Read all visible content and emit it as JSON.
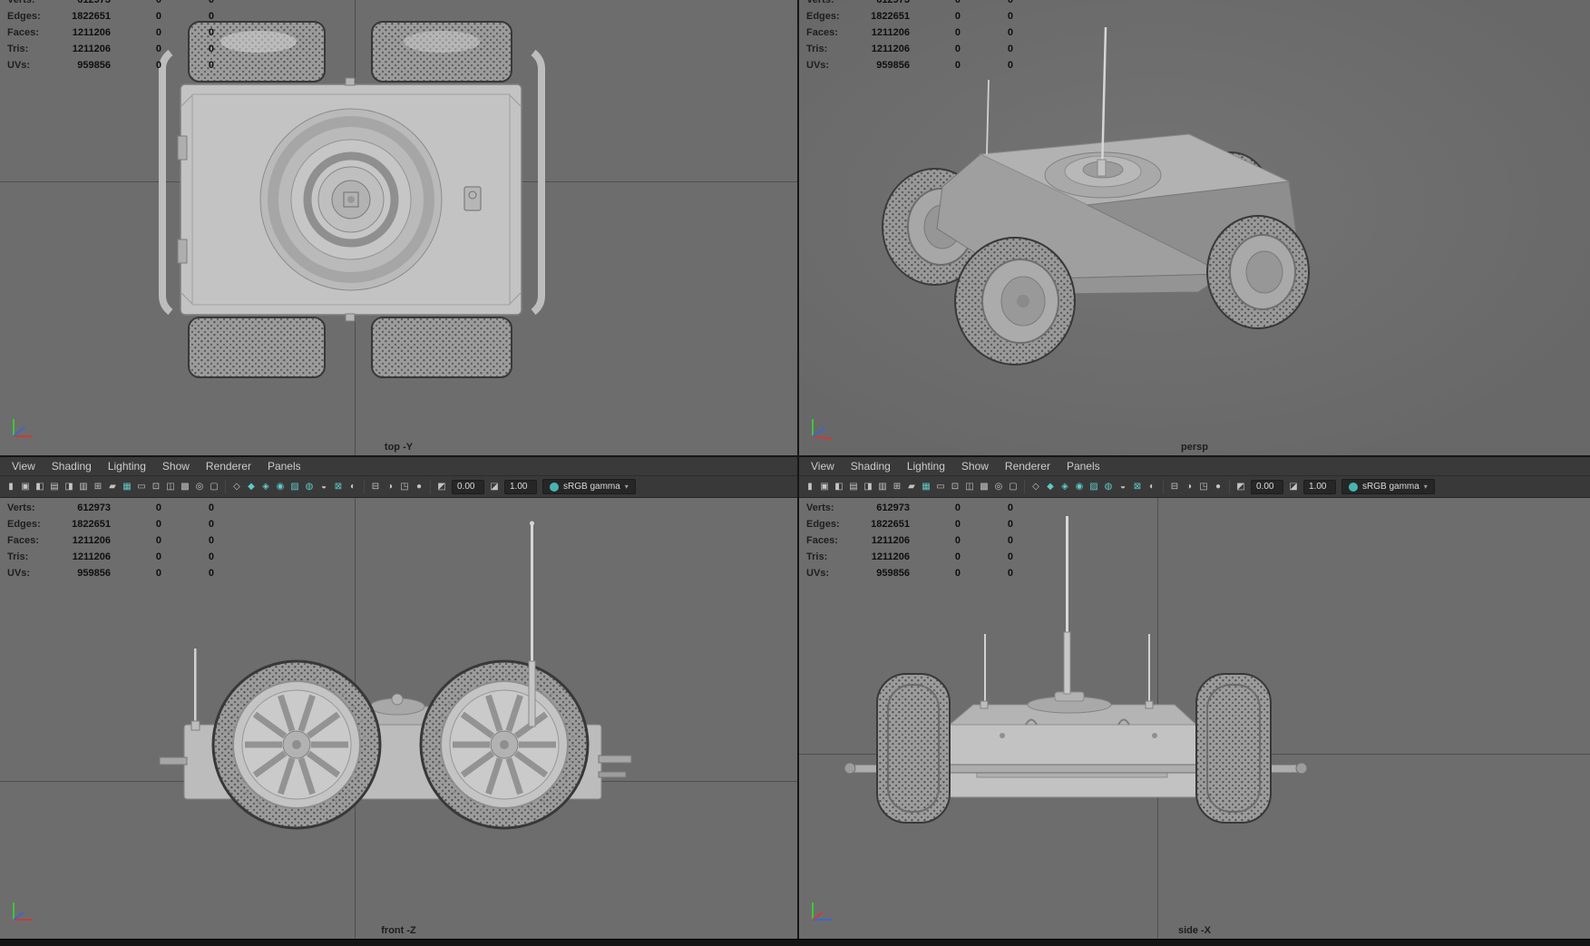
{
  "colors": {
    "viewport_bg": "#6d6d6d",
    "menubar_bg": "#3a3a3a",
    "toolbar_bg": "#393939",
    "accent_teal": "#5fc9c9",
    "axis_x_red": "#cc3a3a",
    "axis_y_green": "#3fc43f",
    "axis_z_blue": "#3c66cc"
  },
  "stats": {
    "rows": [
      {
        "label": "Verts:",
        "v1": "612973",
        "v2": "0",
        "v3": "0"
      },
      {
        "label": "Edges:",
        "v1": "1822651",
        "v2": "0",
        "v3": "0"
      },
      {
        "label": "Faces:",
        "v1": "1211206",
        "v2": "0",
        "v3": "0"
      },
      {
        "label": "Tris:",
        "v1": "1211206",
        "v2": "0",
        "v3": "0"
      },
      {
        "label": "UVs:",
        "v1": "959856",
        "v2": "0",
        "v3": "0"
      }
    ]
  },
  "panel_menu": {
    "items": [
      "View",
      "Shading",
      "Lighting",
      "Show",
      "Renderer",
      "Panels"
    ]
  },
  "toolbar": {
    "exposure_value": "0.00",
    "gamma_value": "1.00",
    "view_transform": "sRGB gamma",
    "caret": "▾",
    "icons_a": [
      {
        "name": "toolbar-grip-icon",
        "glyph": "▮"
      },
      {
        "name": "select-camera-icon",
        "glyph": "▣"
      },
      {
        "name": "lock-camera-icon",
        "glyph": "◧"
      },
      {
        "name": "camera-attributes-icon",
        "glyph": "▤"
      },
      {
        "name": "bookmarks-icon",
        "glyph": "◨"
      },
      {
        "name": "image-plane-icon",
        "glyph": "▥"
      },
      {
        "name": "two-d-pan-zoom-icon",
        "glyph": "⊞"
      },
      {
        "name": "grease-pencil-icon",
        "glyph": "▰"
      },
      {
        "name": "grid-icon",
        "glyph": "▦",
        "teal": true
      },
      {
        "name": "film-gate-icon",
        "glyph": "▭"
      },
      {
        "name": "resolution-gate-icon",
        "glyph": "⊡"
      },
      {
        "name": "gate-mask-icon",
        "glyph": "◫"
      },
      {
        "name": "field-chart-icon",
        "glyph": "▩"
      },
      {
        "name": "safe-action-icon",
        "glyph": "◎"
      },
      {
        "name": "safe-title-icon",
        "glyph": "▢"
      }
    ],
    "icons_b": [
      {
        "name": "wireframe-icon",
        "glyph": "◇"
      },
      {
        "name": "shaded-icon",
        "glyph": "◆",
        "teal": true
      },
      {
        "name": "textured-icon",
        "glyph": "◈",
        "teal": true
      },
      {
        "name": "use-all-lights-icon",
        "glyph": "◉",
        "teal": true
      },
      {
        "name": "shadows-icon",
        "glyph": "▨",
        "teal": true
      },
      {
        "name": "screen-space-ao-icon",
        "glyph": "◍",
        "teal": true
      },
      {
        "name": "motion-blur-icon",
        "glyph": "◒"
      },
      {
        "name": "anti-aliasing-icon",
        "glyph": "⊠",
        "teal": true
      },
      {
        "name": "depth-of-field-icon",
        "glyph": "◐"
      }
    ],
    "icons_c": [
      {
        "name": "isolate-select-icon",
        "glyph": "⊟"
      },
      {
        "name": "x-ray-icon",
        "glyph": "◑"
      },
      {
        "name": "wireframe-on-shaded-icon",
        "glyph": "◳"
      },
      {
        "name": "default-material-icon",
        "glyph": "●"
      }
    ],
    "exposure_icon": {
      "name": "exposure-icon",
      "glyph": "◩"
    },
    "gamma_icon": {
      "name": "gamma-icon",
      "glyph": "◪"
    }
  },
  "viewports": {
    "top": {
      "label": "top -Y"
    },
    "persp": {
      "label": "persp"
    },
    "front": {
      "label": "front -Z"
    },
    "side": {
      "label": "side -X"
    }
  }
}
